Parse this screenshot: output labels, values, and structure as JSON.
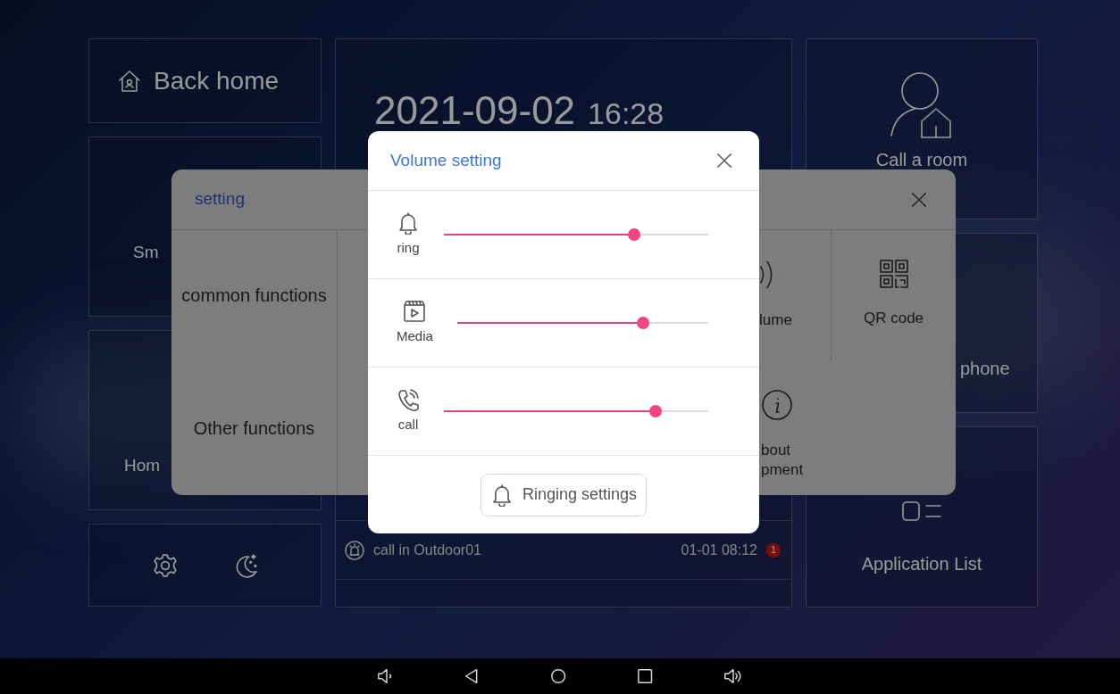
{
  "home": {
    "back_home": {
      "label": "Back home"
    },
    "tile_smart": {
      "label": "Sm"
    },
    "tile_home": {
      "label": "Hom"
    },
    "clock": {
      "date": "2021-09-02",
      "time": "16:28"
    },
    "events": [
      {
        "text": "call in Outdoor01",
        "time": "01-01 08:12",
        "badge": "1"
      }
    ],
    "call_room": {
      "label": "Call a room"
    },
    "tile_phone": {
      "label": "phone"
    },
    "app_list": {
      "label": "Application List"
    }
  },
  "setting_dialog": {
    "title": "setting",
    "categories": [
      "common functions",
      "Other functions"
    ],
    "items": [
      {
        "kind": "volume",
        "lines": [
          "lume"
        ]
      },
      {
        "kind": "qr",
        "lines": [
          "QR code"
        ]
      },
      {
        "kind": "about",
        "lines": [
          "bout",
          "pment"
        ]
      }
    ]
  },
  "volume_dialog": {
    "title": "Volume setting",
    "channels": [
      {
        "kind": "bell",
        "name": "ring",
        "level": 0.72
      },
      {
        "kind": "media",
        "name": "Media",
        "level": 0.74
      },
      {
        "kind": "call",
        "name": "call",
        "level": 0.8
      }
    ],
    "button": "Ringing settings"
  }
}
